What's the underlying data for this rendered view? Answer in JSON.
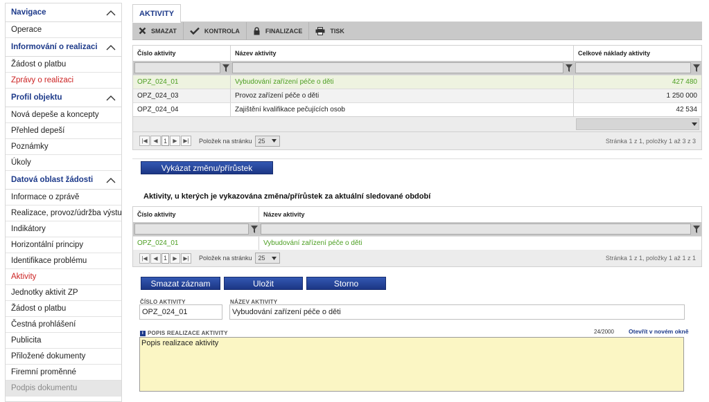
{
  "sidebar": {
    "sections": [
      {
        "title": "Navigace",
        "items": [
          {
            "label": "Operace"
          }
        ]
      },
      {
        "title": "Informování o realizaci",
        "items": [
          {
            "label": "Žádost o platbu"
          },
          {
            "label": "Zprávy o realizaci",
            "state": "active"
          }
        ]
      },
      {
        "title": "Profil objektu",
        "items": [
          {
            "label": "Nová depeše a koncepty"
          },
          {
            "label": "Přehled depeší"
          },
          {
            "label": "Poznámky"
          },
          {
            "label": "Úkoly"
          }
        ]
      },
      {
        "title": "Datová oblast žádosti",
        "items": [
          {
            "label": "Informace o zprávě"
          },
          {
            "label": "Realizace, provoz/údržba výstupu"
          },
          {
            "label": "Indikátory"
          },
          {
            "label": "Horizontální principy"
          },
          {
            "label": "Identifikace problému"
          },
          {
            "label": "Aktivity",
            "state": "active"
          },
          {
            "label": "Jednotky aktivit ZP"
          },
          {
            "label": "Žádost o platbu"
          },
          {
            "label": "Čestná prohlášení"
          },
          {
            "label": "Publicita"
          },
          {
            "label": "Přiložené dokumenty"
          },
          {
            "label": "Firemní proměnné"
          },
          {
            "label": "Podpis dokumentu",
            "state": "disabled"
          }
        ]
      }
    ]
  },
  "tab": {
    "label": "AKTIVITY"
  },
  "toolbar": {
    "delete": "SMAZAT",
    "check": "KONTROLA",
    "finalize": "FINALIZACE",
    "print": "TISK"
  },
  "grid1": {
    "columns": [
      "Číslo aktivity",
      "Název aktivity",
      "Celkové náklady aktivity"
    ],
    "rows": [
      [
        "OPZ_024_01",
        "Vybudování zařízení péče o děti",
        "427 480"
      ],
      [
        "OPZ_024_03",
        "Provoz zařízení péče o děti",
        "1 250 000"
      ],
      [
        "OPZ_024_04",
        "Zajištění kvalifikace pečujících osob",
        "42 534"
      ]
    ],
    "pager": {
      "page": "1",
      "per_page_label": "Položek na stránku",
      "per_page": "25",
      "info": "Stránka 1 z 1, položky 1 až 3 z 3"
    }
  },
  "report_button": "Vykázat změnu/přírůstek",
  "section2_title": "Aktivity, u kterých je vykazována změna/přírůstek za aktuální sledované období",
  "grid2": {
    "columns": [
      "Číslo aktivity",
      "Název aktivity"
    ],
    "rows": [
      [
        "OPZ_024_01",
        "Vybudování zařízení péče o děti"
      ]
    ],
    "pager": {
      "page": "1",
      "per_page_label": "Položek na stránku",
      "per_page": "25",
      "info": "Stránka 1 z 1, položky 1 až 1 z 1"
    }
  },
  "form": {
    "delete_btn": "Smazat záznam",
    "save_btn": "Uložit",
    "cancel_btn": "Storno",
    "number_label": "ČÍSLO AKTIVITY",
    "number_value": "OPZ_024_01",
    "name_label": "NÁZEV AKTIVITY",
    "name_value": "Vybudování zařízení péče o děti",
    "desc_label": "POPIS REALIZACE AKTIVITY",
    "desc_counter": "24/2000",
    "desc_open_link": "Otevřít v novém okně",
    "desc_value": "Popis realizace aktivity"
  },
  "colors": {
    "nav_title": "#1d3a8a",
    "active_link": "#cc2222",
    "selected_row": "#4b9e21",
    "button": "#1f3a8c",
    "textarea_bg": "#fbf6c4"
  }
}
